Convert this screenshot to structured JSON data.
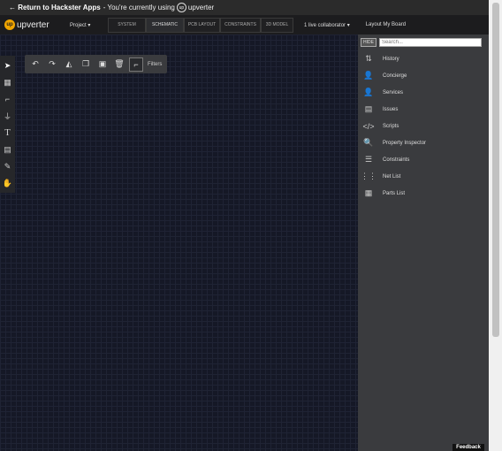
{
  "topbar": {
    "return_text": "← Return to Hackster Apps",
    "using_text": " - You're currently using ",
    "brand": "upverter"
  },
  "navbar": {
    "brand": "upverter",
    "project": "Project ▾",
    "tabs": [
      "SYSTEM",
      "SCHEMATIC",
      "PCB LAYOUT",
      "CONSTRAINTS",
      "3D MODEL"
    ],
    "active_tab": "SCHEMATIC",
    "collaborators": "1 live collaborator ▾",
    "layout_board": "Layout My Board"
  },
  "tools": [
    "pointer-icon",
    "grid-icon",
    "wire-icon",
    "ground-icon",
    "text-icon",
    "note-icon",
    "pen-icon",
    "hand-icon"
  ],
  "floatbar": {
    "filters_label": "Filters"
  },
  "side_panel": {
    "hide_label": "HIDE",
    "search_placeholder": "Search...",
    "items": [
      {
        "label": "History",
        "icon": "history-icon"
      },
      {
        "label": "Concierge",
        "icon": "concierge-icon"
      },
      {
        "label": "Services",
        "icon": "services-icon"
      },
      {
        "label": "Issues",
        "icon": "issues-icon"
      },
      {
        "label": "Scripts",
        "icon": "scripts-icon"
      },
      {
        "label": "Property Inspector",
        "icon": "inspector-icon"
      },
      {
        "label": "Constraints",
        "icon": "constraints-icon"
      },
      {
        "label": "Net List",
        "icon": "netlist-icon"
      },
      {
        "label": "Parts List",
        "icon": "partslist-icon"
      }
    ]
  },
  "feedback": "Feedback",
  "colors": {
    "canvas": "#151826",
    "panel": "#3a3b3e",
    "accent": "#f0a500"
  }
}
